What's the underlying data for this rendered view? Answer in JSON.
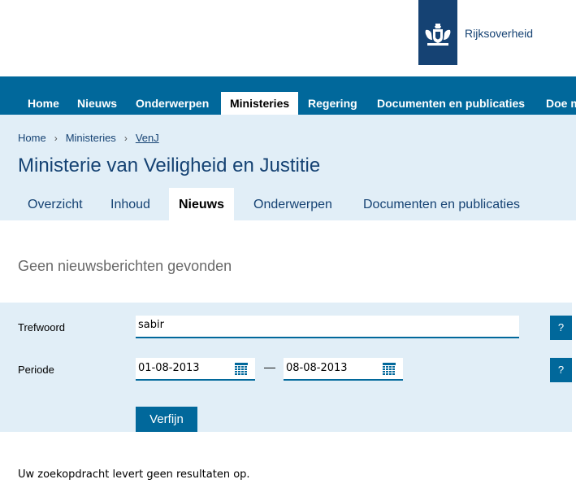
{
  "brand": {
    "logo_text": "Rijksoverheid",
    "color": "#154273"
  },
  "mainnav": {
    "items": [
      {
        "label": "Home"
      },
      {
        "label": "Nieuws"
      },
      {
        "label": "Onderwerpen"
      },
      {
        "label": "Ministeries"
      },
      {
        "label": "Regering"
      },
      {
        "label": "Documenten en publicaties"
      },
      {
        "label": "Doe m"
      }
    ],
    "active": "Ministeries",
    "color": "#01689b"
  },
  "breadcrumb": {
    "items": [
      "Home",
      "Ministeries",
      "VenJ"
    ],
    "separator": "›"
  },
  "page": {
    "title": "Ministerie van Veiligheid en Justitie"
  },
  "subtabs": {
    "items": [
      {
        "label": "Overzicht"
      },
      {
        "label": "Inhoud"
      },
      {
        "label": "Nieuws"
      },
      {
        "label": "Onderwerpen"
      },
      {
        "label": "Documenten en publicaties"
      }
    ],
    "active": "Nieuws"
  },
  "results": {
    "heading": "Geen nieuwsberichten gevonden",
    "none_message": "Uw zoekopdracht levert geen resultaten op."
  },
  "filter": {
    "keyword_label": "Trefwoord",
    "keyword_value": "sabir",
    "period_label": "Periode",
    "date_from": "01-08-2013",
    "date_to": "08-08-2013",
    "range_separator": "—",
    "help_label": "?",
    "submit_label": "Verfijn",
    "panel_color": "#e1eef7"
  }
}
